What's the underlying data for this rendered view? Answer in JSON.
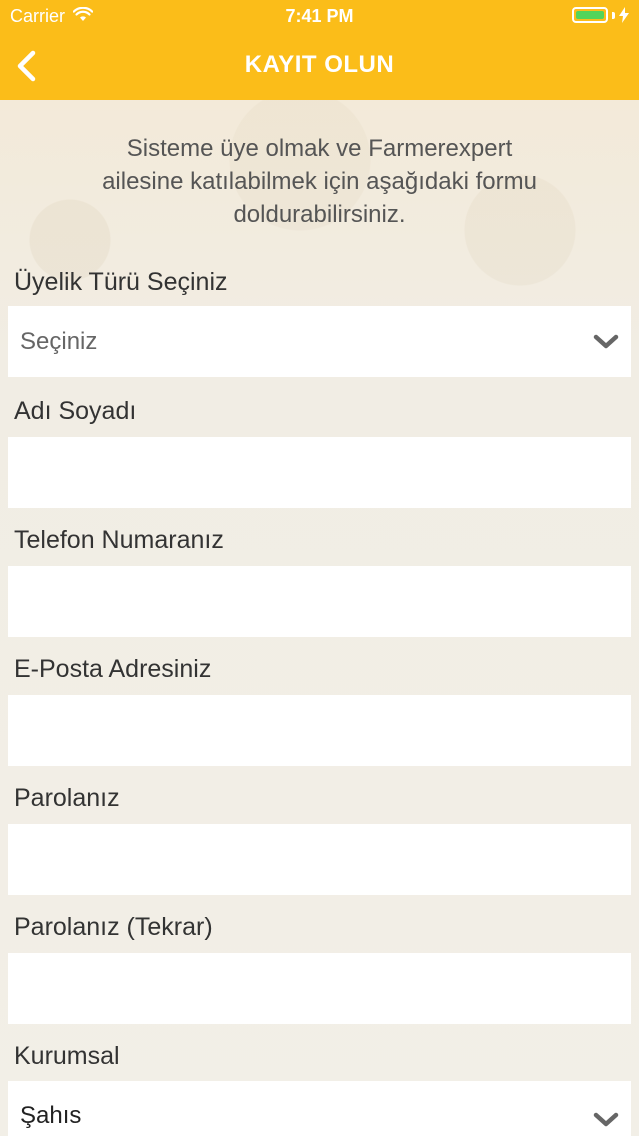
{
  "status_bar": {
    "carrier": "Carrier",
    "time": "7:41 PM",
    "wifi_icon": "wifi-icon",
    "battery_icon": "battery-icon"
  },
  "nav": {
    "title": "KAYIT OLUN",
    "back_icon": "chevron-left-icon"
  },
  "intro": {
    "line1": "Sisteme üye olmak ve Farmerexpert",
    "line2": "ailesine katılabilmek için aşağıdaki formu",
    "line3": "doldurabilirsiniz."
  },
  "form": {
    "membership_type": {
      "label": "Üyelik Türü Seçiniz",
      "value": "Seçiniz"
    },
    "full_name": {
      "label": "Adı Soyadı",
      "value": ""
    },
    "phone": {
      "label": "Telefon Numaranız",
      "value": ""
    },
    "email": {
      "label": "E-Posta Adresiniz",
      "value": ""
    },
    "password": {
      "label": "Parolanız",
      "value": ""
    },
    "password_repeat": {
      "label": "Parolanız (Tekrar)",
      "value": ""
    },
    "corporate": {
      "label": "Kurumsal",
      "value": "Şahıs"
    }
  },
  "colors": {
    "header": "#fbbd19",
    "background": "#f2efe6",
    "field": "#ffffff",
    "battery_fill": "#53d45a"
  }
}
